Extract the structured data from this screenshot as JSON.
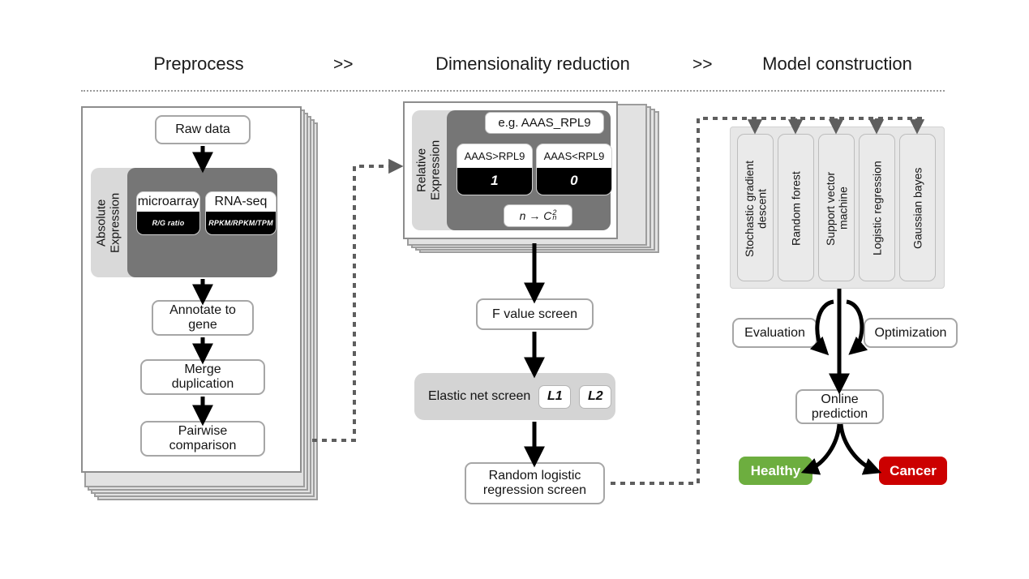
{
  "header": {
    "stages": [
      {
        "label": "Preprocess"
      },
      {
        "label": "Dimensionality reduction"
      },
      {
        "label": "Model construction"
      }
    ],
    "separators": [
      ">>",
      ">>"
    ]
  },
  "preprocess": {
    "raw_data": "Raw data",
    "absolute_expression_label": "Absolute\nExpression",
    "platforms": [
      {
        "name": "microarray",
        "metric": "R/G ratio"
      },
      {
        "name": "RNA-seq",
        "metric": "RPKM/RPKM/TPM"
      }
    ],
    "steps": [
      "Annotate to\ngene",
      "Merge\nduplication",
      "Pairwise\ncomparison"
    ]
  },
  "dimensionality_reduction": {
    "relative_expression_label": "Relative\nExpression",
    "example_pair": "e.g. AAAS_RPL9",
    "comparisons": [
      {
        "condition": "AAAS>RPL9",
        "value": "1"
      },
      {
        "condition": "AAAS<RPL9",
        "value": "0"
      }
    ],
    "combination_formula": "n → C",
    "combination_sup": "2",
    "combination_sub": "n",
    "f_value_screen": "F value screen",
    "elastic_net": {
      "label": "Elastic net screen",
      "penalties": [
        "L1",
        "L2"
      ]
    },
    "random_logistic": "Random logistic\nregression screen"
  },
  "model_construction": {
    "classifiers": [
      "Stochastic gradient\ndescent",
      "Random forest",
      "Support vector\nmachine",
      "Logistic regression",
      "Gaussian bayes"
    ],
    "evaluation": "Evaluation",
    "optimization": "Optimization",
    "online_prediction": "Online\nprediction",
    "outcomes": [
      {
        "label": "Healthy",
        "color": "#6DAE3F"
      },
      {
        "label": "Cancer",
        "color": "#CC0000"
      }
    ]
  },
  "colors": {
    "dark_group": "#767676",
    "light_group": "#D9D9D9",
    "panel_gray": "#E7E7E7",
    "box_border": "#A6A6A6",
    "dotted_line": "#6E6E6E",
    "healthy_green": "#6DAE3F",
    "cancer_red": "#CC0000"
  }
}
